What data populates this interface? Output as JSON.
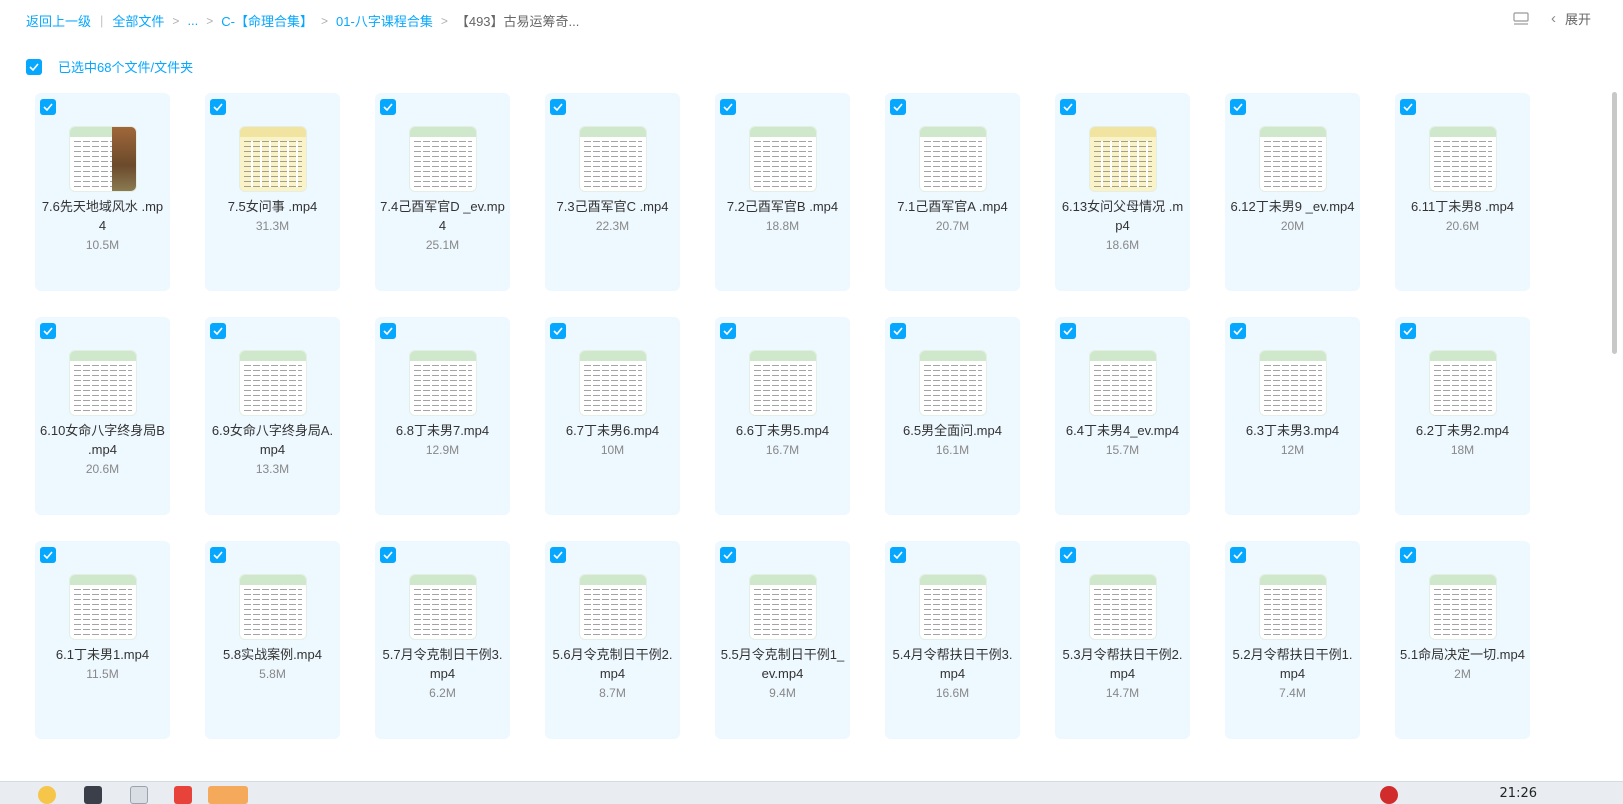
{
  "breadcrumb": {
    "back": "返回上一级",
    "all_files": "全部文件",
    "ellipsis": "...",
    "level1": "C-【命理合集】",
    "level2": "01-八字课程合集",
    "current": "【493】古易运筹奇..."
  },
  "toolbar": {
    "expand_label": "展开"
  },
  "selection": {
    "text": "已选中68个文件/文件夹"
  },
  "colors": {
    "accent": "#06a7ff",
    "tile_bg": "#eef8ff"
  },
  "files": [
    {
      "name": "7.6先天地域风水 .mp4",
      "size": "10.5M"
    },
    {
      "name": "7.5女问事 .mp4",
      "size": "31.3M"
    },
    {
      "name": "7.4己酉军官D _ev.mp4",
      "size": "25.1M"
    },
    {
      "name": "7.3己酉军官C .mp4",
      "size": "22.3M"
    },
    {
      "name": "7.2己酉军官B .mp4",
      "size": "18.8M"
    },
    {
      "name": "7.1己酉军官A .mp4",
      "size": "20.7M"
    },
    {
      "name": "6.13女问父母情况 .mp4",
      "size": "18.6M"
    },
    {
      "name": "6.12丁未男9 _ev.mp4",
      "size": "20M"
    },
    {
      "name": "6.11丁未男8 .mp4",
      "size": "20.6M"
    },
    {
      "name": "6.10女命八字终身局B .mp4",
      "size": "20.6M"
    },
    {
      "name": "6.9女命八字终身局A.mp4",
      "size": "13.3M"
    },
    {
      "name": "6.8丁未男7.mp4",
      "size": "12.9M"
    },
    {
      "name": "6.7丁未男6.mp4",
      "size": "10M"
    },
    {
      "name": "6.6丁未男5.mp4",
      "size": "16.7M"
    },
    {
      "name": "6.5男全面问.mp4",
      "size": "16.1M"
    },
    {
      "name": "6.4丁未男4_ev.mp4",
      "size": "15.7M"
    },
    {
      "name": "6.3丁未男3.mp4",
      "size": "12M"
    },
    {
      "name": "6.2丁未男2.mp4",
      "size": "18M"
    },
    {
      "name": "6.1丁未男1.mp4",
      "size": "11.5M"
    },
    {
      "name": "5.8实战案例.mp4",
      "size": "5.8M"
    },
    {
      "name": "5.7月令克制日干例3.mp4",
      "size": "6.2M"
    },
    {
      "name": "5.6月令克制日干例2.mp4",
      "size": "8.7M"
    },
    {
      "name": "5.5月令克制日干例1_ev.mp4",
      "size": "9.4M"
    },
    {
      "name": "5.4月令帮扶日干例3.mp4",
      "size": "16.6M"
    },
    {
      "name": "5.3月令帮扶日干例2.mp4",
      "size": "14.7M"
    },
    {
      "name": "5.2月令帮扶日干例1.mp4",
      "size": "7.4M"
    },
    {
      "name": "5.1命局决定一切.mp4",
      "size": "2M"
    }
  ],
  "taskbar": {
    "clock": "21:26"
  }
}
